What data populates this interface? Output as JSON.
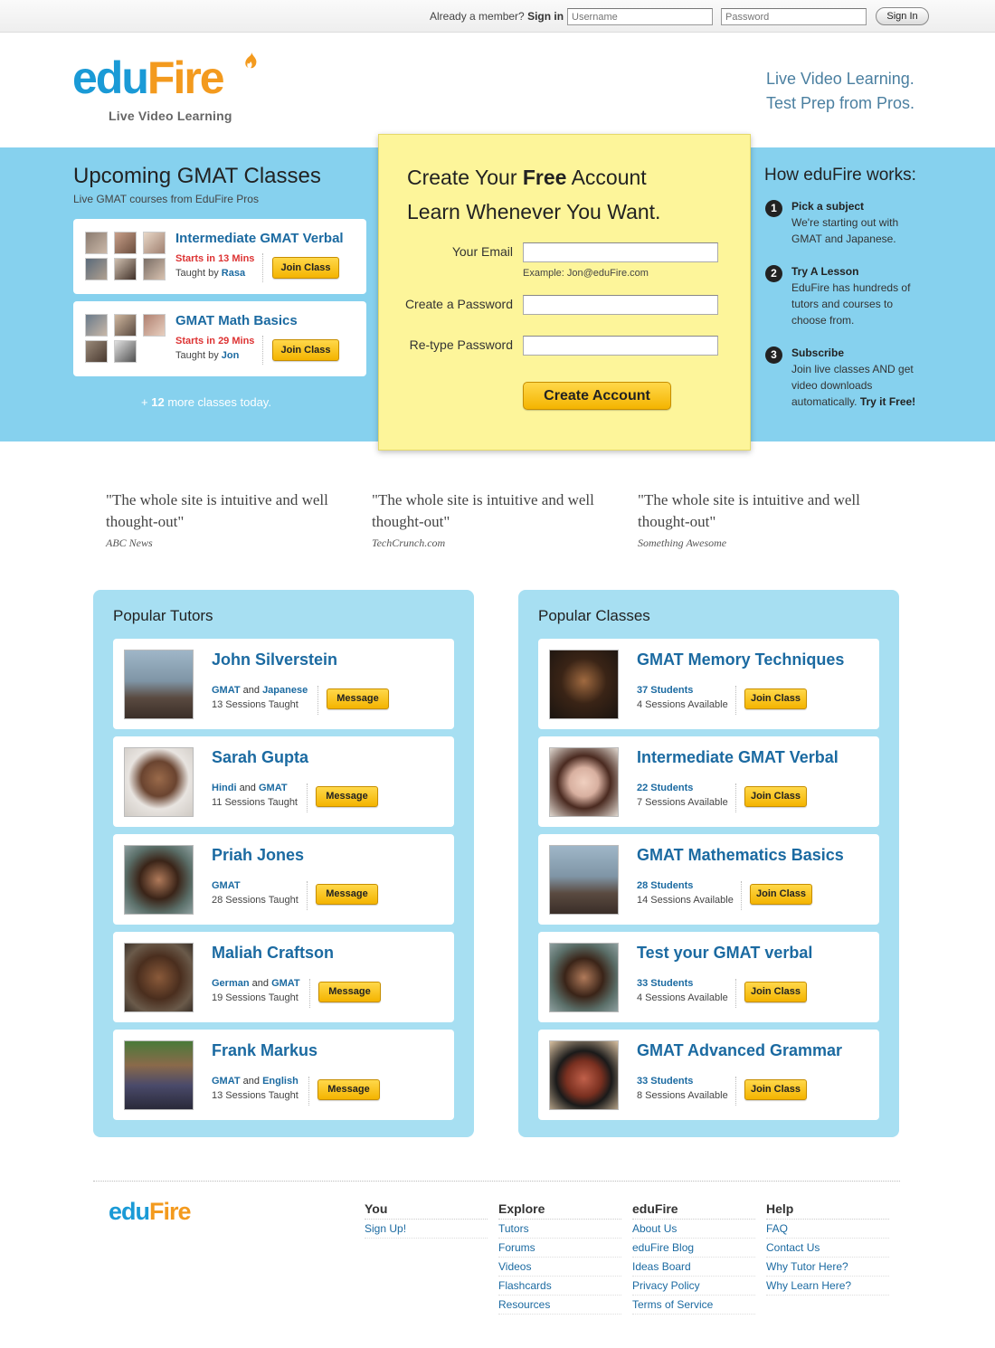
{
  "topbar": {
    "already_member": "Already a member?",
    "sign_in_label": "Sign in",
    "username_placeholder": "Username",
    "password_placeholder": "Password",
    "sign_in_button": "Sign In"
  },
  "header": {
    "logo_edu": "edu",
    "logo_fire": "Fire",
    "logo_tagline": "Live Video Learning",
    "tagline_line1": "Live Video Learning.",
    "tagline_line2": "Test Prep from Pros."
  },
  "upcoming": {
    "title": "Upcoming GMAT Classes",
    "subtitle": "Live GMAT courses from EduFire Pros",
    "classes": [
      {
        "title": "Intermediate GMAT Verbal",
        "starts": "Starts in 13 Mins",
        "taught_by_label": "Taught by",
        "tutor": "Rasa",
        "button": "Join Class"
      },
      {
        "title": "GMAT Math Basics",
        "starts": "Starts in 29 Mins",
        "taught_by_label": "Taught by",
        "tutor": "Jon",
        "button": "Join Class"
      }
    ],
    "more_prefix": "+",
    "more_count": "12",
    "more_suffix": "more classes today."
  },
  "signup": {
    "heading_pre": "Create Your",
    "heading_bold": "Free",
    "heading_post": "Account",
    "heading_line2": "Learn Whenever You Want.",
    "email_label": "Your Email",
    "email_example": "Example: Jon@eduFire.com",
    "password_label": "Create a Password",
    "retype_label": "Re-type Password",
    "create_button": "Create Account"
  },
  "how": {
    "title": "How eduFire works:",
    "steps": [
      {
        "num": "1",
        "title": "Pick a subject",
        "text": "We're starting out with GMAT and Japanese."
      },
      {
        "num": "2",
        "title": "Try A Lesson",
        "text": "EduFire has hundreds of tutors and courses to choose from."
      },
      {
        "num": "3",
        "title": "Subscribe",
        "text": "Join live classes AND get video downloads automatically.",
        "cta": "Try it Free!"
      }
    ]
  },
  "quotes": [
    {
      "text": "\"The whole site is intuitive and well thought-out\"",
      "source": "ABC News"
    },
    {
      "text": "\"The whole site is intuitive and well thought-out\"",
      "source": "TechCrunch.com"
    },
    {
      "text": "\"The whole site is intuitive and well thought-out\"",
      "source": "Something Awesome"
    }
  ],
  "popular_tutors": {
    "title": "Popular Tutors",
    "and_word": "and",
    "items": [
      {
        "name": "John Silverstein",
        "subj1": "GMAT",
        "subj2": "Japanese",
        "sessions": "13 Sessions Taught",
        "button": "Message"
      },
      {
        "name": "Sarah Gupta",
        "subj1": "Hindi",
        "subj2": "GMAT",
        "sessions": "11 Sessions Taught",
        "button": "Message"
      },
      {
        "name": "Priah Jones",
        "subj1": "GMAT",
        "subj2": "",
        "sessions": "28 Sessions Taught",
        "button": "Message"
      },
      {
        "name": "Maliah Craftson",
        "subj1": "German",
        "subj2": "GMAT",
        "sessions": "19 Sessions Taught",
        "button": "Message"
      },
      {
        "name": "Frank Markus",
        "subj1": "GMAT",
        "subj2": "English",
        "sessions": "13 Sessions Taught",
        "button": "Message"
      }
    ]
  },
  "popular_classes": {
    "title": "Popular Classes",
    "items": [
      {
        "name": "GMAT Memory Techniques",
        "students": "37 Students",
        "sessions": "4 Sessions Available",
        "button": "Join Class"
      },
      {
        "name": "Intermediate GMAT Verbal",
        "students": "22 Students",
        "sessions": "7 Sessions Available",
        "button": "Join Class"
      },
      {
        "name": "GMAT Mathematics Basics",
        "students": "28 Students",
        "sessions": "14 Sessions Available",
        "button": "Join Class"
      },
      {
        "name": "Test your GMAT verbal",
        "students": "33 Students",
        "sessions": "4 Sessions Available",
        "button": "Join Class"
      },
      {
        "name": "GMAT Advanced Grammar",
        "students": "33 Students",
        "sessions": "8 Sessions Available",
        "button": "Join Class"
      }
    ]
  },
  "footer": {
    "logo_edu": "edu",
    "logo_fire": "Fire",
    "columns": [
      {
        "heading": "You",
        "items": [
          "Sign Up!"
        ]
      },
      {
        "heading": "Explore",
        "items": [
          "Tutors",
          "Forums",
          "Videos",
          "Flashcards",
          "Resources"
        ]
      },
      {
        "heading": "eduFire",
        "items": [
          "About Us",
          "eduFire Blog",
          "Ideas Board",
          "Privacy Policy",
          "Terms of Service"
        ]
      },
      {
        "heading": "Help",
        "items": [
          "FAQ",
          "Contact Us",
          "Why Tutor Here?",
          "Why Learn Here?"
        ]
      }
    ]
  },
  "colors": {
    "brand_blue": "#1a9ad6",
    "brand_orange": "#f39a1e",
    "band_blue": "#86d1ee",
    "panel_blue": "#a7dff2",
    "note_yellow": "#fdf59a",
    "link_blue": "#1b6aa1",
    "alert_red": "#d33",
    "button_yellow": "#f4b400"
  }
}
